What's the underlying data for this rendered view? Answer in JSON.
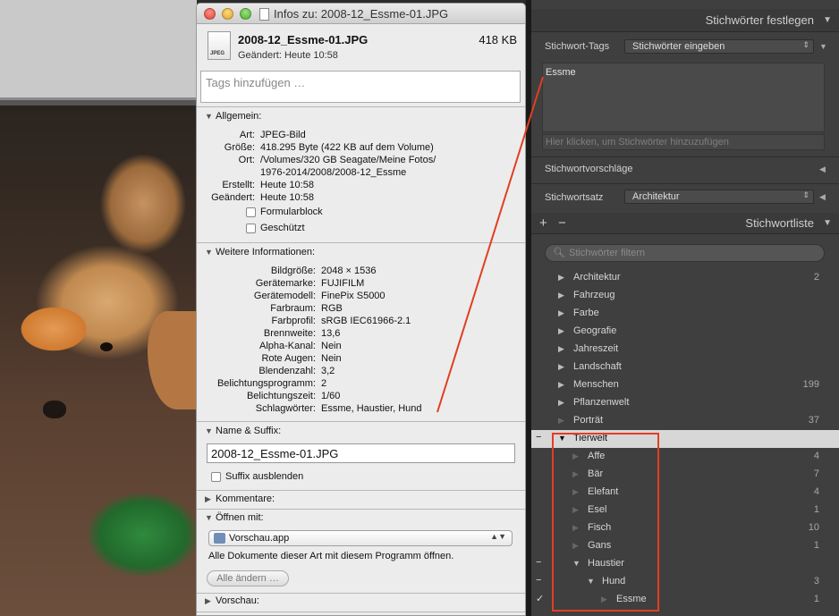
{
  "info_window": {
    "title": "Infos zu: 2008-12_Essme-01.JPG",
    "file_icon_label": "JPEG",
    "file_name": "2008-12_Essme-01.JPG",
    "file_size": "418 KB",
    "changed": "Geändert: Heute 10:58",
    "tags_placeholder": "Tags hinzufügen …",
    "general": {
      "header": "Allgemein:",
      "rows": [
        {
          "k": "Art:",
          "v": "JPEG-Bild"
        },
        {
          "k": "Größe:",
          "v": "418.295 Byte (422 KB auf dem Volume)"
        },
        {
          "k": "Ort:",
          "v": "/Volumes/320 GB Seagate/Meine Fotos/"
        },
        {
          "k": "",
          "v": "1976-2014/2008/2008-12_Essme"
        },
        {
          "k": "Erstellt:",
          "v": "Heute 10:58"
        },
        {
          "k": "Geändert:",
          "v": "Heute 10:58"
        }
      ],
      "stationery": "Formularblock",
      "locked": "Geschützt"
    },
    "more_info": {
      "header": "Weitere Informationen:",
      "rows": [
        {
          "k": "Bildgröße:",
          "v": "2048 × 1536"
        },
        {
          "k": "Gerätemarke:",
          "v": "FUJIFILM"
        },
        {
          "k": "Gerätemodell:",
          "v": "FinePix S5000"
        },
        {
          "k": "Farbraum:",
          "v": "RGB"
        },
        {
          "k": "Farbprofil:",
          "v": "sRGB IEC61966-2.1"
        },
        {
          "k": "Brennweite:",
          "v": "13,6"
        },
        {
          "k": "Alpha-Kanal:",
          "v": "Nein"
        },
        {
          "k": "Rote Augen:",
          "v": "Nein"
        },
        {
          "k": "Blendenzahl:",
          "v": "3,2"
        },
        {
          "k": "Belichtungsprogramm:",
          "v": "2"
        },
        {
          "k": "Belichtungszeit:",
          "v": "1/60"
        },
        {
          "k": "Schlagwörter:",
          "v": "Essme, Haustier, Hund"
        }
      ]
    },
    "name_suffix": {
      "header": "Name & Suffix:",
      "value": "2008-12_Essme-01.JPG",
      "hide_suffix": "Suffix ausblenden"
    },
    "comments_header": "Kommentare:",
    "open_with": {
      "header": "Öffnen mit:",
      "app": "Vorschau.app",
      "description": "Alle Dokumente dieser Art mit diesem Programm öffnen.",
      "change_all": "Alle ändern …"
    },
    "preview_header": "Vorschau:"
  },
  "lightroom": {
    "keywording_title": "Stichwörter festlegen",
    "keyword_tags_label": "Stichwort-Tags",
    "keyword_tags_select": "Stichwörter eingeben",
    "keywords_text": "Essme",
    "keywords_hint": "Hier klicken, um Stichwörter hinzuzufügen",
    "suggestions_label": "Stichwortvorschläge",
    "keyword_set_label": "Stichwortsatz",
    "keyword_set_value": "Architektur",
    "keyword_list_title": "Stichwortliste",
    "add_symbol": "+",
    "remove_symbol": "−",
    "filter_placeholder": "Stichwörter filtern",
    "keywords": [
      {
        "label": "Architektur",
        "count": "2",
        "level": 0,
        "disc": "▶",
        "dim": false,
        "mark": "",
        "selected": false
      },
      {
        "label": "Fahrzeug",
        "count": "",
        "level": 0,
        "disc": "▶",
        "dim": false,
        "mark": "",
        "selected": false
      },
      {
        "label": "Farbe",
        "count": "",
        "level": 0,
        "disc": "▶",
        "dim": false,
        "mark": "",
        "selected": false
      },
      {
        "label": "Geografie",
        "count": "",
        "level": 0,
        "disc": "▶",
        "dim": false,
        "mark": "",
        "selected": false
      },
      {
        "label": "Jahreszeit",
        "count": "",
        "level": 0,
        "disc": "▶",
        "dim": false,
        "mark": "",
        "selected": false
      },
      {
        "label": "Landschaft",
        "count": "",
        "level": 0,
        "disc": "▶",
        "dim": false,
        "mark": "",
        "selected": false
      },
      {
        "label": "Menschen",
        "count": "199",
        "level": 0,
        "disc": "▶",
        "dim": false,
        "mark": "",
        "selected": false
      },
      {
        "label": "Pflanzenwelt",
        "count": "",
        "level": 0,
        "disc": "▶",
        "dim": false,
        "mark": "",
        "selected": false
      },
      {
        "label": "Porträt",
        "count": "37",
        "level": 0,
        "disc": "▶",
        "dim": true,
        "mark": "",
        "selected": false
      },
      {
        "label": "Tierwelt",
        "count": "",
        "level": 0,
        "disc": "▼",
        "dim": false,
        "mark": "−",
        "selected": true
      },
      {
        "label": "Affe",
        "count": "4",
        "level": 1,
        "disc": "▶",
        "dim": true,
        "mark": "",
        "selected": false
      },
      {
        "label": "Bär",
        "count": "7",
        "level": 1,
        "disc": "▶",
        "dim": true,
        "mark": "",
        "selected": false
      },
      {
        "label": "Elefant",
        "count": "4",
        "level": 1,
        "disc": "▶",
        "dim": true,
        "mark": "",
        "selected": false
      },
      {
        "label": "Esel",
        "count": "1",
        "level": 1,
        "disc": "▶",
        "dim": true,
        "mark": "",
        "selected": false
      },
      {
        "label": "Fisch",
        "count": "10",
        "level": 1,
        "disc": "▶",
        "dim": true,
        "mark": "",
        "selected": false
      },
      {
        "label": "Gans",
        "count": "1",
        "level": 1,
        "disc": "▶",
        "dim": true,
        "mark": "",
        "selected": false
      },
      {
        "label": "Haustier",
        "count": "",
        "level": 1,
        "disc": "▼",
        "dim": false,
        "mark": "−",
        "selected": false
      },
      {
        "label": "Hund",
        "count": "3",
        "level": 2,
        "disc": "▼",
        "dim": false,
        "mark": "−",
        "selected": false
      },
      {
        "label": "Essme",
        "count": "1",
        "level": 3,
        "disc": "▶",
        "dim": true,
        "mark": "✓",
        "selected": false
      }
    ]
  },
  "colors": {
    "annotation": "#e23e22",
    "selected_row": "#d7d7d7"
  }
}
